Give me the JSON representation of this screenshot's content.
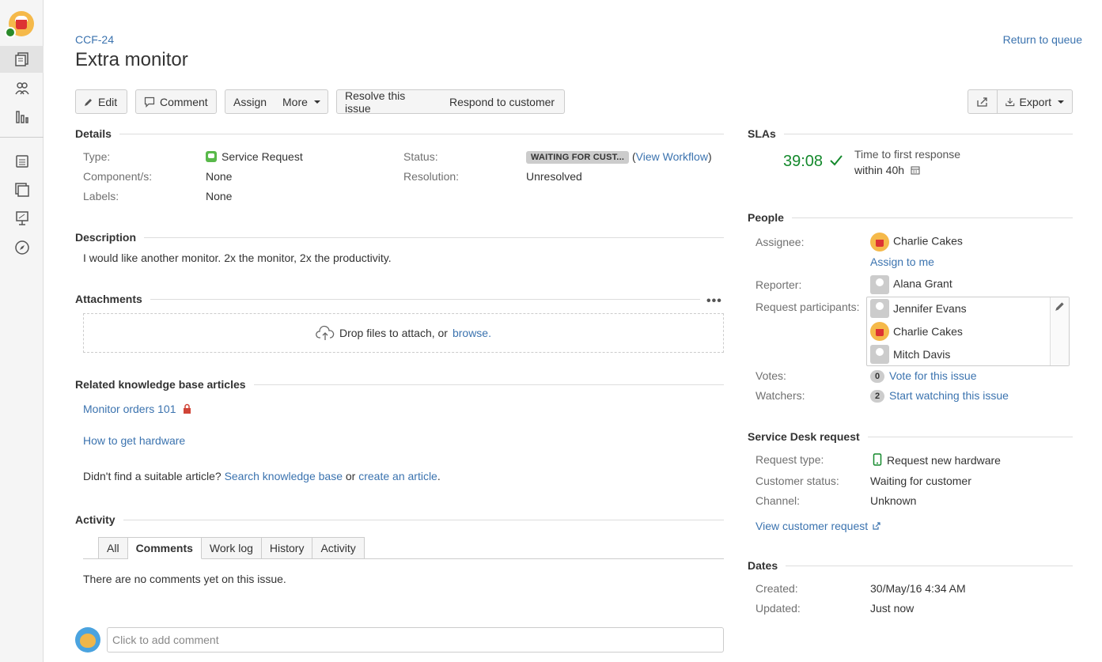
{
  "issue": {
    "key": "CCF-24",
    "title": "Extra monitor",
    "return_link": "Return to queue"
  },
  "toolbar": {
    "edit": "Edit",
    "comment": "Comment",
    "assign": "Assign",
    "more": "More",
    "resolve": "Resolve this issue",
    "respond": "Respond to customer",
    "export": "Export"
  },
  "details": {
    "heading": "Details",
    "type_label": "Type:",
    "type_value": "Service Request",
    "component_label": "Component/s:",
    "component_value": "None",
    "labels_label": "Labels:",
    "labels_value": "None",
    "status_label": "Status:",
    "status_value": "WAITING FOR CUST...",
    "view_workflow": "View Workflow",
    "resolution_label": "Resolution:",
    "resolution_value": "Unresolved"
  },
  "description": {
    "heading": "Description",
    "text": "I would like another monitor. 2x the monitor, 2x the productivity."
  },
  "attachments": {
    "heading": "Attachments",
    "drop_text": "Drop files to attach, or",
    "browse": "browse."
  },
  "kb": {
    "heading": "Related knowledge base articles",
    "articles": [
      "Monitor orders 101",
      "How to get hardware"
    ],
    "not_found": "Didn't find a suitable article?",
    "search": "Search knowledge base",
    "or": "or",
    "create": "create an article",
    "period": "."
  },
  "activity": {
    "heading": "Activity",
    "tabs": [
      "All",
      "Comments",
      "Work log",
      "History",
      "Activity"
    ],
    "active_tab": "Comments",
    "empty": "There are no comments yet on this issue.",
    "comment_placeholder": "Click to add comment"
  },
  "slas": {
    "heading": "SLAs",
    "time": "39:08",
    "label": "Time to first response",
    "within": "within 40h",
    "color": "#14892c"
  },
  "people": {
    "heading": "People",
    "assignee_label": "Assignee:",
    "assignee": "Charlie Cakes",
    "assign_to_me": "Assign to me",
    "reporter_label": "Reporter:",
    "reporter": "Alana Grant",
    "participants_label": "Request participants:",
    "participants": [
      "Jennifer Evans",
      "Charlie Cakes",
      "Mitch Davis"
    ],
    "votes_label": "Votes:",
    "votes_count": "0",
    "vote_link": "Vote for this issue",
    "watchers_label": "Watchers:",
    "watchers_count": "2",
    "watch_link": "Start watching this issue"
  },
  "service_desk": {
    "heading": "Service Desk request",
    "request_type_label": "Request type:",
    "request_type": "Request new hardware",
    "customer_status_label": "Customer status:",
    "customer_status": "Waiting for customer",
    "channel_label": "Channel:",
    "channel": "Unknown",
    "view_request": "View customer request"
  },
  "dates": {
    "heading": "Dates",
    "created_label": "Created:",
    "created": "30/May/16 4:34 AM",
    "updated_label": "Updated:",
    "updated": "Just now"
  },
  "colors": {
    "link": "#3b73af",
    "sla_green": "#14892c",
    "lock_red": "#d04437"
  }
}
